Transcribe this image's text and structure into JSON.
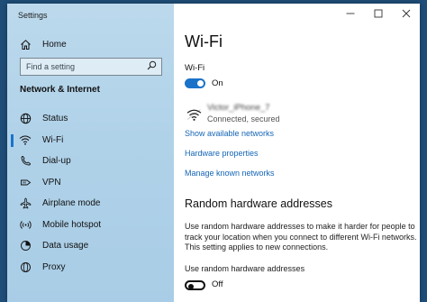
{
  "window": {
    "title": "Settings",
    "controls": {
      "minimize_icon": "minimize-icon",
      "maximize_icon": "maximize-icon",
      "close_icon": "close-icon"
    }
  },
  "sidebar": {
    "home_label": "Home",
    "search_placeholder": "Find a setting",
    "section_title": "Network & Internet",
    "selected_index": 1,
    "items": [
      {
        "label": "Status",
        "icon": "globe-icon"
      },
      {
        "label": "Wi-Fi",
        "icon": "wifi-icon"
      },
      {
        "label": "Dial-up",
        "icon": "phone-icon"
      },
      {
        "label": "VPN",
        "icon": "vpn-icon"
      },
      {
        "label": "Airplane mode",
        "icon": "airplane-icon"
      },
      {
        "label": "Mobile hotspot",
        "icon": "hotspot-icon"
      },
      {
        "label": "Data usage",
        "icon": "data-usage-icon"
      },
      {
        "label": "Proxy",
        "icon": "proxy-icon"
      }
    ]
  },
  "main": {
    "title": "Wi-Fi",
    "wifi_label": "Wi-Fi",
    "wifi_state": "On",
    "network": {
      "name": "Victor_iPhone_7",
      "status": "Connected, secured"
    },
    "links": {
      "show_available": "Show available networks",
      "hardware_properties": "Hardware properties",
      "manage_known": "Manage known networks"
    },
    "random_hw": {
      "title": "Random hardware addresses",
      "description": "Use random hardware addresses to make it harder for people to track your location when you connect to different Wi-Fi networks. This setting applies to new connections.",
      "option_label": "Use random hardware addresses",
      "state": "Off"
    }
  },
  "colors": {
    "accent": "#1a73c9",
    "link": "#1565b6",
    "sidebar_bg": "#b0d2e9",
    "desktop": "#1f4e79"
  }
}
